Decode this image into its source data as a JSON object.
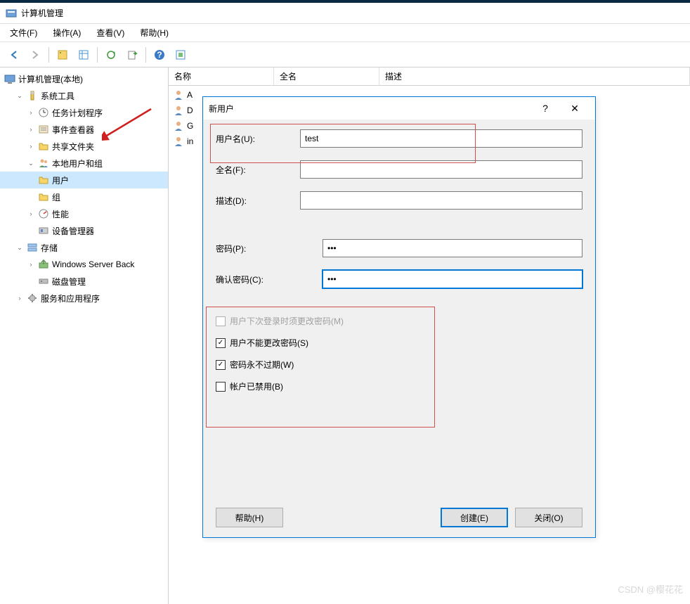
{
  "window": {
    "title": "计算机管理"
  },
  "menubar": {
    "file": "文件(F)",
    "action": "操作(A)",
    "view": "查看(V)",
    "help": "帮助(H)"
  },
  "tree": {
    "root": "计算机管理(本地)",
    "system_tools": "系统工具",
    "task_scheduler": "任务计划程序",
    "event_viewer": "事件查看器",
    "shared_folders": "共享文件夹",
    "local_users_groups": "本地用户和组",
    "users": "用户",
    "groups": "组",
    "performance": "性能",
    "device_manager": "设备管理器",
    "storage": "存储",
    "wsb": "Windows Server Back",
    "disk_mgmt": "磁盘管理",
    "services_apps": "服务和应用程序"
  },
  "list": {
    "cols": {
      "name": "名称",
      "fullname": "全名",
      "desc": "描述"
    },
    "rows": [
      "A",
      "D",
      "G",
      "in"
    ]
  },
  "dialog": {
    "title": "新用户",
    "username_label": "用户名(U):",
    "username_value": "test",
    "fullname_label": "全名(F):",
    "fullname_value": "",
    "desc_label": "描述(D):",
    "desc_value": "",
    "password_label": "密码(P):",
    "password_value": "•••",
    "confirm_label": "确认密码(C):",
    "confirm_value": "•••",
    "opt_must_change": "用户下次登录时须更改密码(M)",
    "opt_cant_change": "用户不能更改密码(S)",
    "opt_never_expire": "密码永不过期(W)",
    "opt_disabled": "帐户已禁用(B)",
    "btn_help": "帮助(H)",
    "btn_create": "创建(E)",
    "btn_close": "关闭(O)"
  },
  "watermark": "CSDN @樱花花"
}
